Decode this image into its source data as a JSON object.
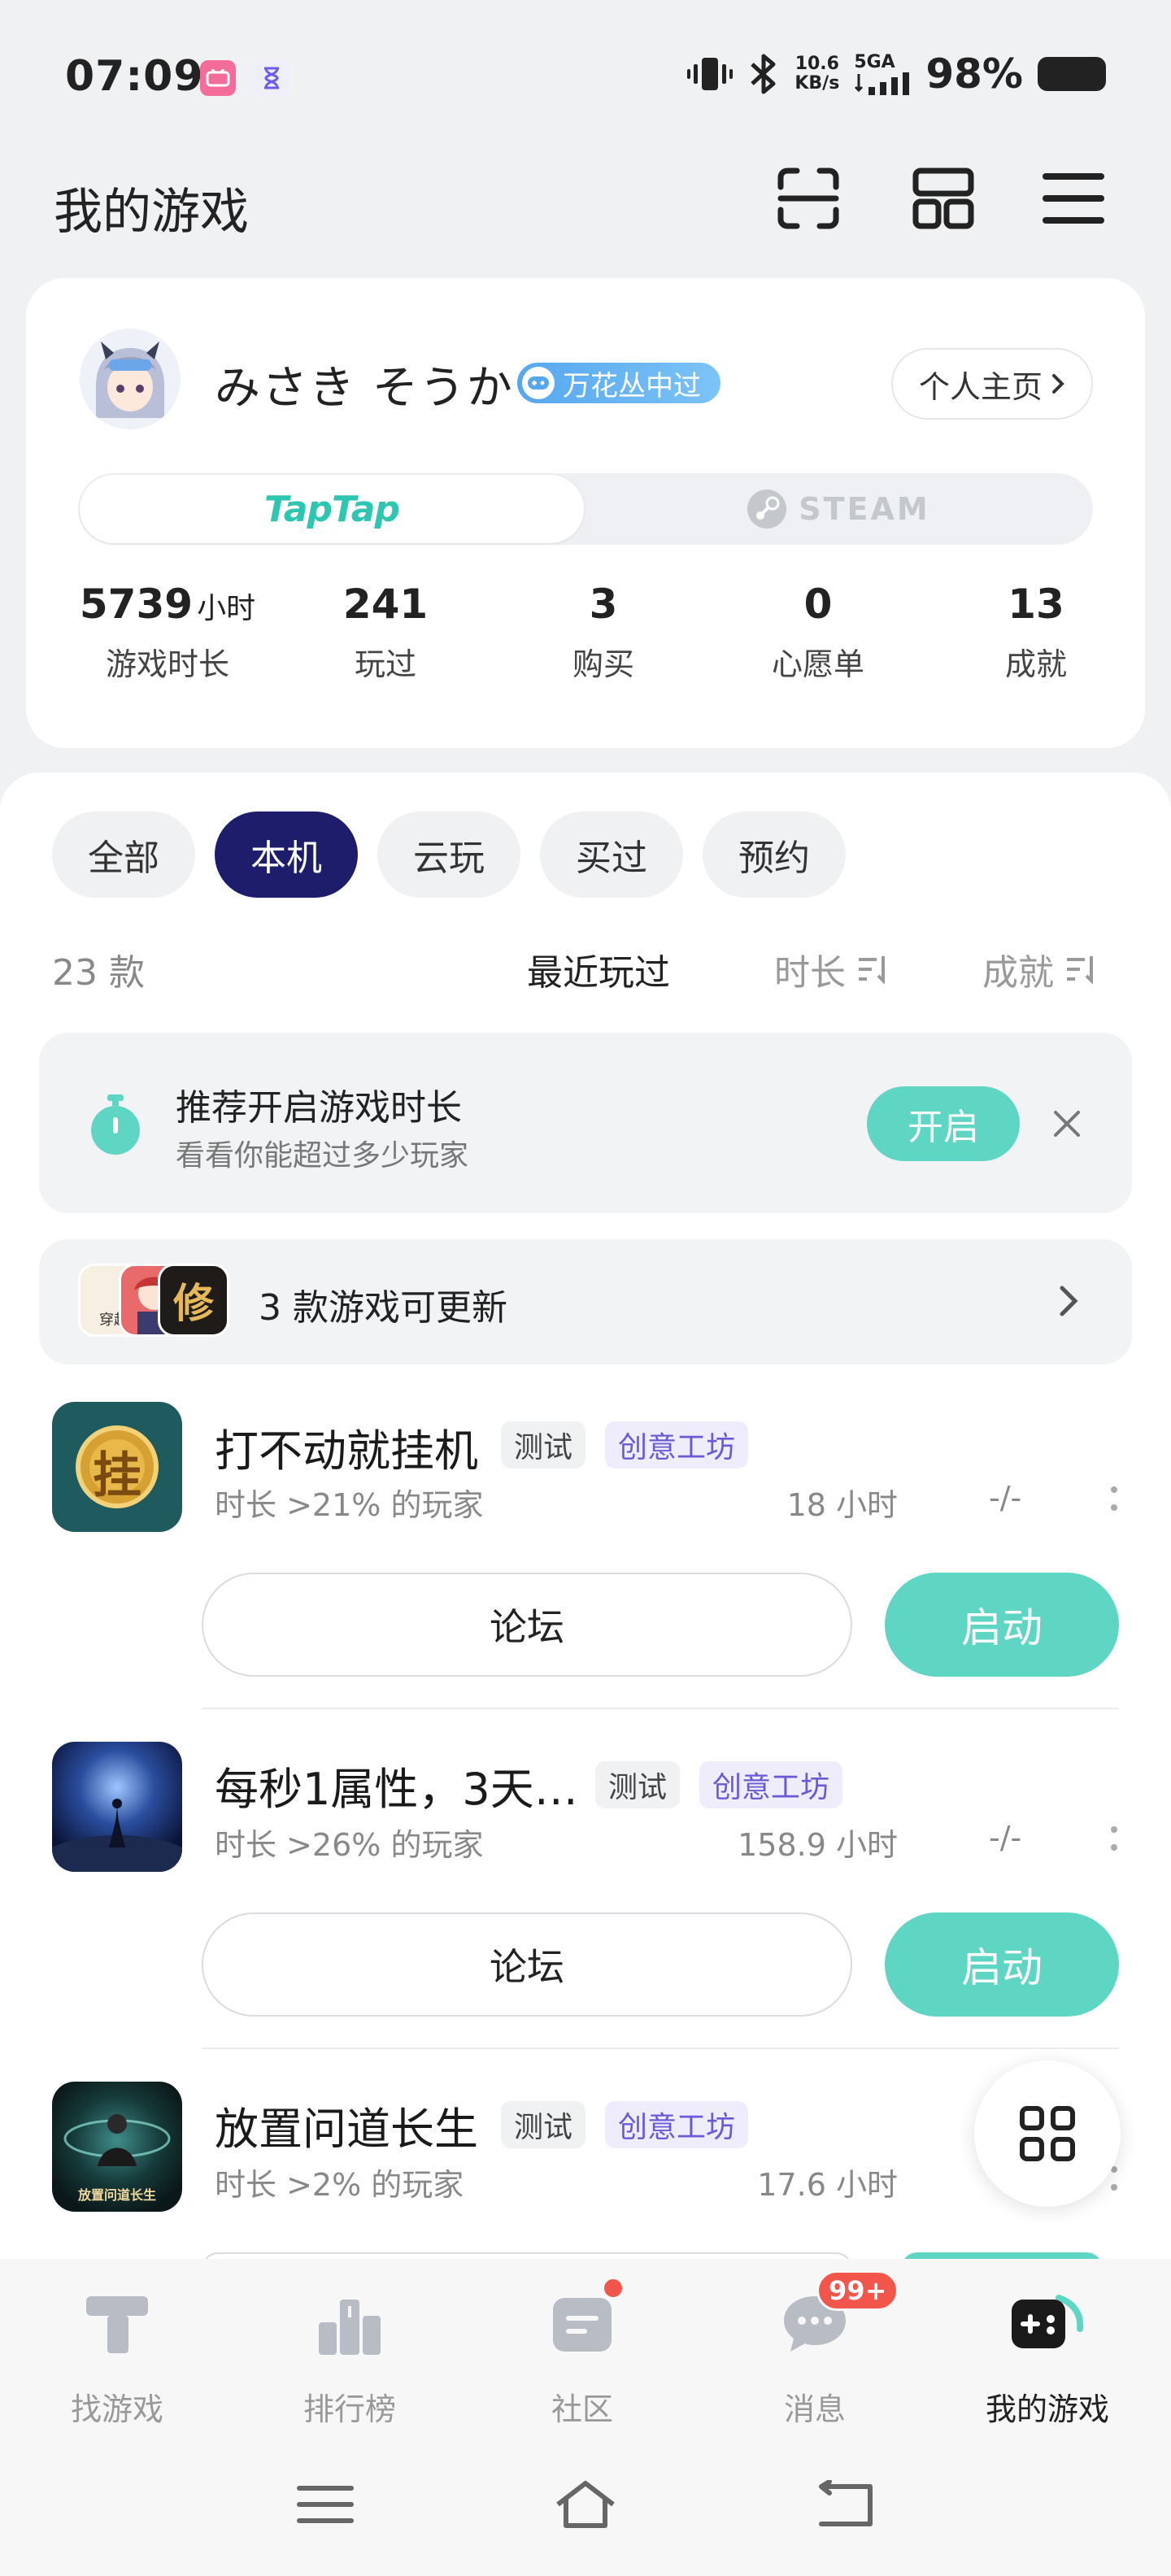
{
  "status_bar": {
    "time": "07:09",
    "net_speed_value": "10.6",
    "net_speed_unit": "KB/s",
    "network": "5GA",
    "battery": "98%"
  },
  "header": {
    "title": "我的游戏"
  },
  "profile": {
    "username": "みさき そうか",
    "badge": "万花丛中过",
    "home_button": "个人主页",
    "platforms": {
      "taptap": "TapTap",
      "steam": "STEAM"
    },
    "stats": [
      {
        "value": "5739",
        "unit": "小时",
        "label": "游戏时长"
      },
      {
        "value": "241",
        "unit": "",
        "label": "玩过"
      },
      {
        "value": "3",
        "unit": "",
        "label": "购买"
      },
      {
        "value": "0",
        "unit": "",
        "label": "心愿单"
      },
      {
        "value": "13",
        "unit": "",
        "label": "成就"
      }
    ]
  },
  "filters": [
    {
      "label": "全部",
      "active": false
    },
    {
      "label": "本机",
      "active": true
    },
    {
      "label": "云玩",
      "active": false
    },
    {
      "label": "买过",
      "active": false
    },
    {
      "label": "预约",
      "active": false
    }
  ],
  "list_meta": {
    "count": "23 款",
    "sort_recent": "最近玩过",
    "sort_duration": "时长",
    "sort_achievement": "成就"
  },
  "tip": {
    "title": "推荐开启游戏时长",
    "subtitle": "看看你能超过多少玩家",
    "button": "开启"
  },
  "update_banner": {
    "text": "3 款游戏可更新",
    "thumb_texts": [
      "穿越",
      "修"
    ]
  },
  "games": [
    {
      "title": "打不动就挂机",
      "icon_text": "挂",
      "tag_test": "测试",
      "tag_workshop": "创意工坊",
      "subtitle": "时长 >21% 的玩家",
      "hours": "18 小时",
      "achievement": "-/-",
      "forum": "论坛",
      "launch": "启动"
    },
    {
      "title": "每秒1属性，3天…",
      "icon_text": "",
      "tag_test": "测试",
      "tag_workshop": "创意工坊",
      "subtitle": "时长 >26% 的玩家",
      "hours": "158.9 小时",
      "achievement": "-/-",
      "forum": "论坛",
      "launch": "启动"
    },
    {
      "title": "放置问道长生",
      "icon_text": "放置问道长生",
      "tag_test": "测试",
      "tag_workshop": "创意工坊",
      "subtitle": "时长 >2% 的玩家",
      "hours": "17.6 小时",
      "achievement": "",
      "forum": "",
      "launch": ""
    }
  ],
  "bottom_nav": [
    {
      "label": "找游戏",
      "icon": "find-game-icon",
      "active": false
    },
    {
      "label": "排行榜",
      "icon": "ranking-icon",
      "active": false
    },
    {
      "label": "社区",
      "icon": "community-icon",
      "active": false
    },
    {
      "label": "消息",
      "icon": "message-icon",
      "active": false
    },
    {
      "label": "我的游戏",
      "icon": "my-games-icon",
      "active": true
    }
  ],
  "message_badge": "99+",
  "colors": {
    "accent": "#5fd6c4",
    "active_chip": "#1e1d6b",
    "badge_red": "#f2554a",
    "workshop_text": "#6a5ad8"
  }
}
